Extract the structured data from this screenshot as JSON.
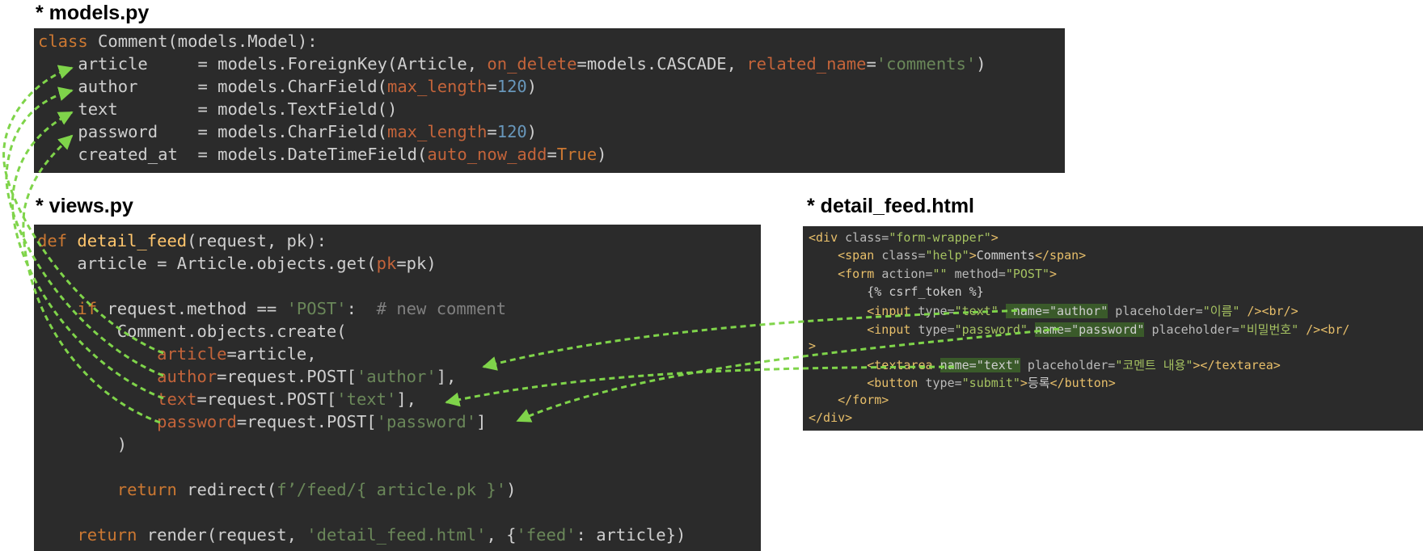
{
  "models": {
    "title": "* models.py",
    "lines": [
      [
        {
          "t": "class",
          "c": "kw"
        },
        {
          "t": " Comment(models.Model):",
          "c": "txt"
        }
      ],
      [
        {
          "t": "    article     = models.ForeignKey(Article, ",
          "c": "txt"
        },
        {
          "t": "on_delete",
          "c": "arg"
        },
        {
          "t": "=models.CASCADE, ",
          "c": "txt"
        },
        {
          "t": "related_name",
          "c": "arg"
        },
        {
          "t": "=",
          "c": "txt"
        },
        {
          "t": "'comments'",
          "c": "str"
        },
        {
          "t": ")",
          "c": "txt"
        }
      ],
      [
        {
          "t": "    author      = models.CharField(",
          "c": "txt"
        },
        {
          "t": "max_length",
          "c": "arg"
        },
        {
          "t": "=",
          "c": "txt"
        },
        {
          "t": "120",
          "c": "num"
        },
        {
          "t": ")",
          "c": "txt"
        }
      ],
      [
        {
          "t": "    text        = models.TextField()",
          "c": "txt"
        }
      ],
      [
        {
          "t": "    password    = models.CharField(",
          "c": "txt"
        },
        {
          "t": "max_length",
          "c": "arg"
        },
        {
          "t": "=",
          "c": "txt"
        },
        {
          "t": "120",
          "c": "num"
        },
        {
          "t": ")",
          "c": "txt"
        }
      ],
      [
        {
          "t": "    created_at  = models.DateTimeField(",
          "c": "txt"
        },
        {
          "t": "auto_now_add",
          "c": "arg"
        },
        {
          "t": "=",
          "c": "txt"
        },
        {
          "t": "True",
          "c": "kw"
        },
        {
          "t": ")",
          "c": "txt"
        }
      ]
    ]
  },
  "views": {
    "title": "* views.py",
    "lines": [
      [
        {
          "t": "def",
          "c": "kw"
        },
        {
          "t": " ",
          "c": "txt"
        },
        {
          "t": "detail_feed",
          "c": "fn"
        },
        {
          "t": "(request, pk):",
          "c": "txt"
        }
      ],
      [
        {
          "t": "    article = Article.objects.get(",
          "c": "txt"
        },
        {
          "t": "pk",
          "c": "arg"
        },
        {
          "t": "=pk)",
          "c": "txt"
        }
      ],
      [],
      [
        {
          "t": "    ",
          "c": "txt"
        },
        {
          "t": "if",
          "c": "kw"
        },
        {
          "t": " request.method == ",
          "c": "txt"
        },
        {
          "t": "'POST'",
          "c": "str"
        },
        {
          "t": ":  ",
          "c": "txt"
        },
        {
          "t": "# new comment",
          "c": "cm"
        }
      ],
      [
        {
          "t": "        Comment.objects.create(",
          "c": "txt"
        }
      ],
      [
        {
          "t": "            ",
          "c": "txt"
        },
        {
          "t": "article",
          "c": "arg"
        },
        {
          "t": "=article,",
          "c": "txt"
        }
      ],
      [
        {
          "t": "            ",
          "c": "txt"
        },
        {
          "t": "author",
          "c": "arg"
        },
        {
          "t": "=request.POST[",
          "c": "txt"
        },
        {
          "t": "'author'",
          "c": "str"
        },
        {
          "t": "],",
          "c": "txt"
        }
      ],
      [
        {
          "t": "            ",
          "c": "txt"
        },
        {
          "t": "text",
          "c": "arg"
        },
        {
          "t": "=request.POST[",
          "c": "txt"
        },
        {
          "t": "'text'",
          "c": "str"
        },
        {
          "t": "],",
          "c": "txt"
        }
      ],
      [
        {
          "t": "            ",
          "c": "txt"
        },
        {
          "t": "password",
          "c": "arg"
        },
        {
          "t": "=request.POST[",
          "c": "txt"
        },
        {
          "t": "'password'",
          "c": "str"
        },
        {
          "t": "]",
          "c": "txt"
        }
      ],
      [
        {
          "t": "        )",
          "c": "txt"
        }
      ],
      [],
      [
        {
          "t": "        ",
          "c": "txt"
        },
        {
          "t": "return",
          "c": "kw"
        },
        {
          "t": " redirect(",
          "c": "txt"
        },
        {
          "t": "f’/feed/{ article.pk }'",
          "c": "str"
        },
        {
          "t": ")",
          "c": "txt"
        }
      ],
      [],
      [
        {
          "t": "    ",
          "c": "txt"
        },
        {
          "t": "return",
          "c": "kw"
        },
        {
          "t": " render(request, ",
          "c": "txt"
        },
        {
          "t": "'detail_feed.html'",
          "c": "str"
        },
        {
          "t": ", {",
          "c": "txt"
        },
        {
          "t": "'feed'",
          "c": "str"
        },
        {
          "t": ": article})",
          "c": "txt"
        }
      ]
    ]
  },
  "html": {
    "title": "* detail_feed.html",
    "lines": [
      [
        {
          "t": "<div ",
          "c": "tag"
        },
        {
          "t": "class=",
          "c": "hattr"
        },
        {
          "t": "\"form-wrapper\"",
          "c": "hval"
        },
        {
          "t": ">",
          "c": "tag"
        }
      ],
      [
        {
          "t": "    <span ",
          "c": "tag"
        },
        {
          "t": "class=",
          "c": "hattr"
        },
        {
          "t": "\"help\"",
          "c": "hval"
        },
        {
          "t": ">",
          "c": "tag"
        },
        {
          "t": "Comments",
          "c": "txt"
        },
        {
          "t": "</span>",
          "c": "tag"
        }
      ],
      [
        {
          "t": "    <form ",
          "c": "tag"
        },
        {
          "t": "action=",
          "c": "hattr"
        },
        {
          "t": "\"\"",
          "c": "hval"
        },
        {
          "t": " method=",
          "c": "hattr"
        },
        {
          "t": "\"POST\"",
          "c": "hval"
        },
        {
          "t": ">",
          "c": "tag"
        }
      ],
      [
        {
          "t": "        {% csrf_token %}",
          "c": "txt"
        }
      ],
      [
        {
          "t": "        <input ",
          "c": "tag"
        },
        {
          "t": "type=",
          "c": "hattr"
        },
        {
          "t": "\"text\"",
          "c": "hval"
        },
        {
          "t": " ",
          "c": "txt"
        },
        {
          "t": " name=\"author\"",
          "c": "hl"
        },
        {
          "t": " placeholder=",
          "c": "hattr"
        },
        {
          "t": "\"이름\"",
          "c": "hval"
        },
        {
          "t": " /><br/>",
          "c": "tag"
        }
      ],
      [
        {
          "t": "        <input ",
          "c": "tag"
        },
        {
          "t": "type=",
          "c": "hattr"
        },
        {
          "t": "\"password\"",
          "c": "hval"
        },
        {
          "t": " ",
          "c": "txt"
        },
        {
          "t": "name=\"password\"",
          "c": "hl"
        },
        {
          "t": " placeholder=",
          "c": "hattr"
        },
        {
          "t": "\"비밀번호\"",
          "c": "hval"
        },
        {
          "t": " /><br/",
          "c": "tag"
        }
      ],
      [
        {
          "t": ">",
          "c": "tag"
        }
      ],
      [
        {
          "t": "        <textarea ",
          "c": "tag"
        },
        {
          "t": "name=\"text\"",
          "c": "hl"
        },
        {
          "t": " placeholder=",
          "c": "hattr"
        },
        {
          "t": "\"코멘트 내용\"",
          "c": "hval"
        },
        {
          "t": "></textarea>",
          "c": "tag"
        }
      ],
      [
        {
          "t": "        <button ",
          "c": "tag"
        },
        {
          "t": "type=",
          "c": "hattr"
        },
        {
          "t": "\"submit\"",
          "c": "hval"
        },
        {
          "t": ">",
          "c": "tag"
        },
        {
          "t": "등록",
          "c": "txt"
        },
        {
          "t": "</button>",
          "c": "tag"
        }
      ],
      [
        {
          "t": "    </form>",
          "c": "tag"
        }
      ],
      [
        {
          "t": "</div>",
          "c": "tag"
        }
      ]
    ]
  },
  "arrow_color": "#7fd44a"
}
